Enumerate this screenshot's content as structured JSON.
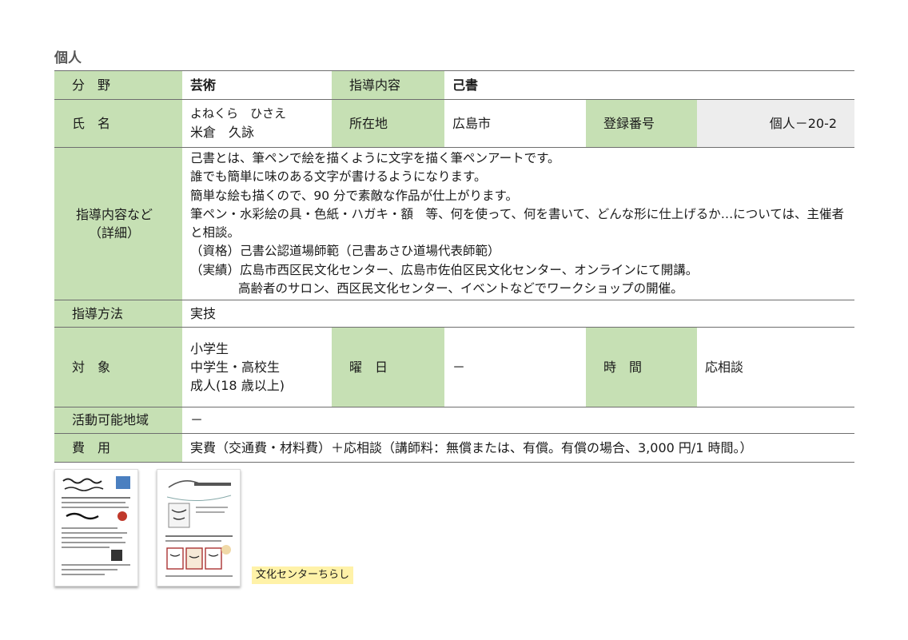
{
  "section_title": "個人",
  "rows": {
    "field": {
      "label": "分　野",
      "value": "芸術",
      "label2": "指導内容",
      "value2": "己書"
    },
    "name": {
      "label": "氏　名",
      "reading": "よねくら　ひさえ",
      "name": "米倉　久詠",
      "location_label": "所在地",
      "location": "広島市",
      "reg_label": "登録番号",
      "reg_no": "個人－20-2"
    },
    "details": {
      "label_line1": "指導内容など",
      "label_line2": "（詳細）",
      "lines": [
        "己書とは、筆ペンで絵を描くように文字を描く筆ペンアートです。",
        "誰でも簡単に味のある文字が書けるようになります。",
        "簡単な絵も描くので、90 分で素敵な作品が仕上がります。",
        "筆ペン・水彩絵の具・色紙・ハガキ・額　等、何を使って、何を書いて、どんな形に仕上げるか…については、主催者と相談。",
        "（資格）己書公認道場師範（己書あさひ道場代表師範）",
        "（実績）広島市西区民文化センター、広島市佐伯区民文化センター、オンラインにて開講。",
        "高齢者のサロン、西区民文化センター、イベントなどでワークショップの開催。"
      ]
    },
    "method": {
      "label": "指導方法",
      "value": "実技"
    },
    "target": {
      "label": "対　象",
      "values": [
        "小学生",
        "中学生・高校生",
        "成人(18 歳以上)"
      ],
      "day_label": "曜　日",
      "day": "－",
      "time_label": "時　間",
      "time": "応相談"
    },
    "area": {
      "label": "活動可能地域",
      "value": "－"
    },
    "cost": {
      "label": "費　用",
      "value": "実費（交通費・材料費）＋応相談（講師料：無償または、有償。有償の場合、3,000 円/1 時間。）"
    }
  },
  "flyer_caption": "文化センターちらし",
  "colors": {
    "label_bg": "#c6e0b4",
    "reg_bg": "#ededed",
    "caption_bg": "#fff2a8"
  }
}
